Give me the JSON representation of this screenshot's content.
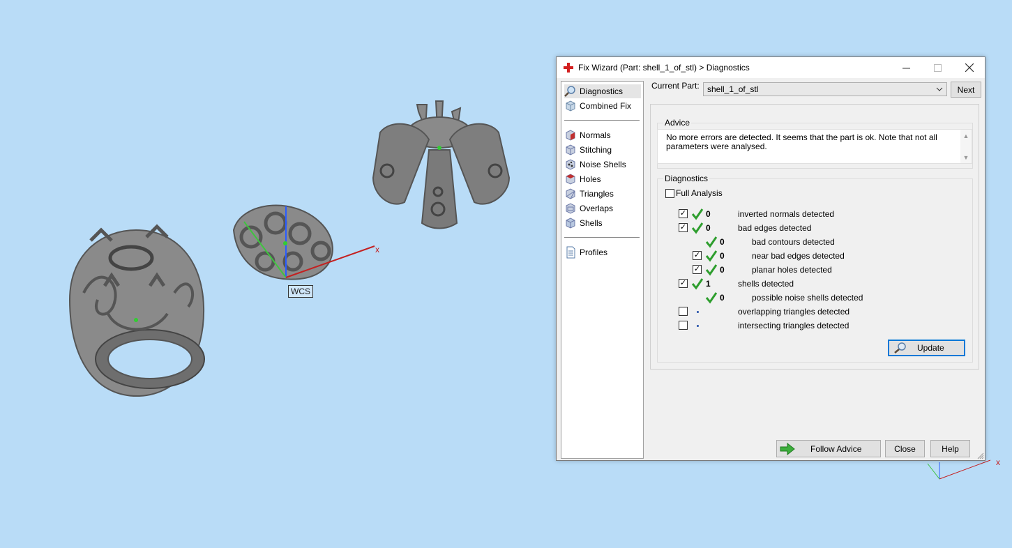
{
  "viewport": {
    "wcs_label": "WCS",
    "axis_x_label": "x",
    "corner_axis_x_label": "x"
  },
  "dialog": {
    "title": "Fix Wizard (Part: shell_1_of_stl) > Diagnostics",
    "nav": {
      "items_top": [
        "Diagnostics",
        "Combined Fix"
      ],
      "items_mid": [
        "Normals",
        "Stitching",
        "Noise Shells",
        "Holes",
        "Triangles",
        "Overlaps",
        "Shells"
      ],
      "items_bottom": [
        "Profiles"
      ]
    },
    "current_part_label": "Current Part:",
    "current_part_value": "shell_1_of_stl",
    "next_label": "Next",
    "advice": {
      "title": "Advice",
      "text": "No more errors are detected. It seems that the part is ok. Note that not all parameters were analysed."
    },
    "diagnostics": {
      "title": "Diagnostics",
      "full_analysis_label": "Full Analysis",
      "rows": [
        {
          "label": "inverted normals detected",
          "count": "0",
          "checked": true,
          "status": "ok"
        },
        {
          "label": "bad edges detected",
          "count": "0",
          "checked": true,
          "status": "ok"
        },
        {
          "label": "bad contours detected",
          "count": "0",
          "checked": null,
          "status": "ok"
        },
        {
          "label": "near bad edges detected",
          "count": "0",
          "checked": true,
          "status": "ok"
        },
        {
          "label": "planar holes detected",
          "count": "0",
          "checked": true,
          "status": "ok"
        },
        {
          "label": "shells detected",
          "count": "1",
          "checked": true,
          "status": "ok"
        },
        {
          "label": "possible noise shells detected",
          "count": "0",
          "checked": null,
          "status": "ok"
        },
        {
          "label": "overlapping triangles detected",
          "count": "",
          "checked": false,
          "status": "none"
        },
        {
          "label": "intersecting triangles detected",
          "count": "",
          "checked": false,
          "status": "none"
        }
      ]
    },
    "update_label": "Update",
    "follow_advice_label": "Follow Advice",
    "close_label": "Close",
    "help_label": "Help"
  },
  "colors": {
    "background": "#b9dcf7",
    "check_green": "#2e9e2e",
    "accent_blue": "#0078d7"
  }
}
